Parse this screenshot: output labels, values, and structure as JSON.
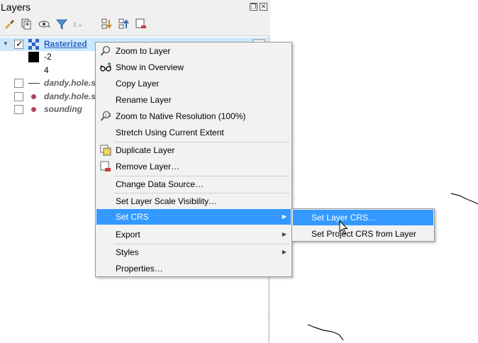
{
  "panel": {
    "title": "Layers",
    "toolbar_icons": [
      "style-brush-icon",
      "add-group-icon",
      "visibility-eye-icon",
      "filter-funnel-icon",
      "expression-filter-icon",
      "expand-all-icon",
      "collapse-all-icon",
      "remove-layer-icon"
    ]
  },
  "tree": {
    "items": [
      {
        "name": "Rasterized",
        "checked": true,
        "selected": true
      },
      {
        "legend": "-2"
      },
      {
        "legend": "4"
      },
      {
        "name": "dandy.hole.so",
        "checked": false
      },
      {
        "name": "dandy.hole.so",
        "checked": false
      },
      {
        "name": "sounding",
        "checked": false
      }
    ]
  },
  "context_menu": {
    "items": [
      {
        "label": "Zoom to Layer",
        "icon": "zoom-magnifier-icon"
      },
      {
        "label": "Show in Overview",
        "icon": "overview-glasses-icon"
      },
      {
        "label": "Copy Layer"
      },
      {
        "label": "Rename Layer"
      },
      {
        "label": "Zoom to Native Resolution (100%)",
        "icon": "zoom-native-icon"
      },
      {
        "label": "Stretch Using Current Extent"
      },
      {
        "label": "Duplicate Layer",
        "icon": "duplicate-layer-icon"
      },
      {
        "label": "Remove Layer…",
        "icon": "remove-layer-icon"
      },
      {
        "label": "Change Data Source…"
      },
      {
        "label": "Set Layer Scale Visibility…"
      },
      {
        "label": "Set CRS",
        "submenu": true,
        "highlighted": true
      },
      {
        "label": "Export",
        "submenu": true
      },
      {
        "label": "Styles",
        "submenu": true
      },
      {
        "label": "Properties…"
      }
    ]
  },
  "submenu": {
    "items": [
      {
        "label": "Set Layer CRS…",
        "highlighted": true
      },
      {
        "label": "Set Project CRS from Layer"
      }
    ]
  },
  "colors": {
    "highlight": "#3399ff",
    "selected_row": "#cce8ff",
    "selected_text": "#2d62bf"
  }
}
